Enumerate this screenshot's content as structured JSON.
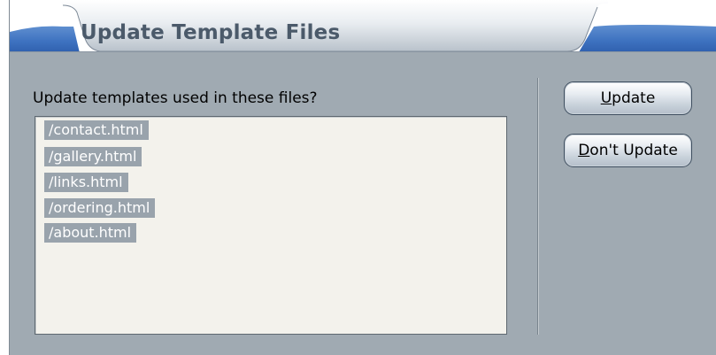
{
  "dialog": {
    "title": "Update Template Files",
    "prompt": "Update templates used in these files?",
    "files": [
      "/contact.html",
      "/gallery.html",
      "/links.html",
      "/ordering.html",
      "/about.html"
    ],
    "buttons": {
      "update": {
        "mnemonic": "U",
        "rest": "pdate"
      },
      "dont_update": {
        "mnemonic": "D",
        "rest": "on't Update"
      }
    }
  },
  "colors": {
    "dialog_background": "#a0aab2",
    "title_text": "#4b5a6a",
    "selection": "#99a3ac",
    "listbox_background": "#f3f2ec"
  }
}
